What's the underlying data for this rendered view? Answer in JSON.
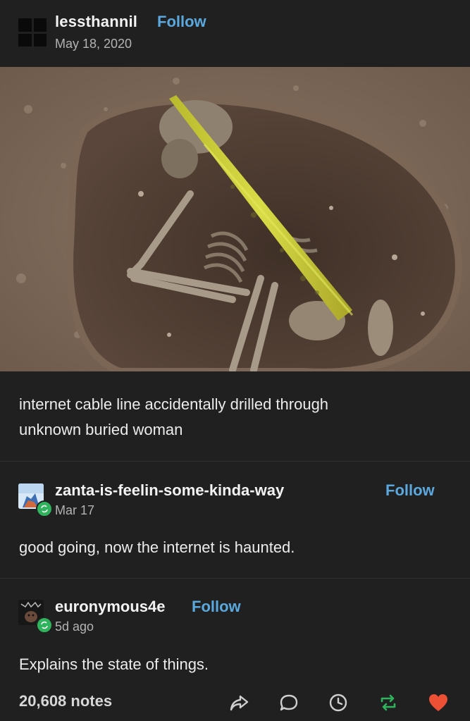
{
  "post": {
    "author": "lessthannil",
    "follow_label": "Follow",
    "date": "May 18, 2020",
    "caption_line1": "internet cable line accidentally drilled through",
    "caption_line2": "unknown buried woman"
  },
  "reblogs": [
    {
      "author": "zanta-is-feelin-some-kinda-way",
      "follow_label": "Follow",
      "time": "Mar 17",
      "text": "good going, now the internet is haunted."
    },
    {
      "author": "euronymous4e",
      "follow_label": "Follow",
      "time": "5d ago",
      "text": "Explains the state of things."
    }
  ],
  "footer": {
    "notes": "20,608 notes",
    "actions": [
      "share-icon",
      "reply-icon",
      "queue-clock-icon",
      "reblog-icon",
      "like-heart-icon"
    ]
  },
  "colors": {
    "background": "#202020",
    "link": "#5aa8de",
    "reblog_green": "#2fb35c",
    "like_red": "#ee5035",
    "cable_yellow": "#d4d63a"
  }
}
